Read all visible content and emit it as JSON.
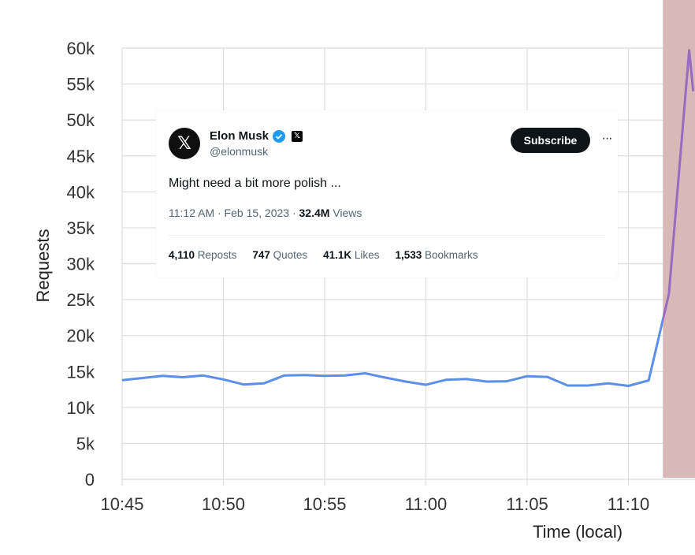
{
  "chart_data": {
    "type": "line",
    "xlabel": "Time (local)",
    "ylabel": "Requests",
    "ylim": [
      0,
      60000
    ],
    "yticks": [
      0,
      5000,
      10000,
      15000,
      20000,
      25000,
      30000,
      35000,
      40000,
      45000,
      50000,
      55000,
      60000
    ],
    "ytick_labels": [
      "0",
      "5k",
      "10k",
      "15k",
      "20k",
      "25k",
      "30k",
      "35k",
      "40k",
      "45k",
      "50k",
      "55k",
      "60k"
    ],
    "xticks": [
      "10:45",
      "10:50",
      "10:55",
      "11:00",
      "11:05",
      "11:10"
    ],
    "grid": true,
    "highlight_region": {
      "from": "11:11.7",
      "color": "#d9b8b8"
    },
    "series": [
      {
        "color": "#5b8fe8",
        "color_in_highlight": "#9a6ac0",
        "x": [
          "10:45",
          "10:46",
          "10:47",
          "10:48",
          "10:49",
          "10:50",
          "10:51",
          "10:52",
          "10:53",
          "10:54",
          "10:55",
          "10:56",
          "10:57",
          "10:58",
          "10:59",
          "11:00",
          "11:01",
          "11:02",
          "11:03",
          "11:04",
          "11:05",
          "11:06",
          "11:07",
          "11:08",
          "11:09",
          "11:10",
          "11:11",
          "11:12",
          "11:13",
          "11:13.2"
        ],
        "values": [
          13800,
          14100,
          14400,
          14200,
          14450,
          13900,
          13200,
          13350,
          14450,
          14500,
          14400,
          14450,
          14750,
          14150,
          13600,
          13150,
          13850,
          13950,
          13600,
          13650,
          14350,
          14250,
          13050,
          13050,
          13350,
          13000,
          13750,
          25800,
          59700,
          54000
        ]
      }
    ]
  },
  "tweet": {
    "avatar_glyph": "𝕏",
    "name": "Elon Musk",
    "badge_glyph": "𝕏",
    "handle": "@elonmusk",
    "subscribe_label": "Subscribe",
    "more_label": "···",
    "text": "Might need a bit more polish ...",
    "timestamp": "11:12 AM · Feb 15, 2023 · ",
    "views_count": "32.4M",
    "views_label": " Views",
    "stats": [
      {
        "count": "4,110",
        "label": " Reposts"
      },
      {
        "count": "747",
        "label": " Quotes"
      },
      {
        "count": "41.1K",
        "label": " Likes"
      },
      {
        "count": "1,533",
        "label": " Bookmarks"
      }
    ]
  }
}
